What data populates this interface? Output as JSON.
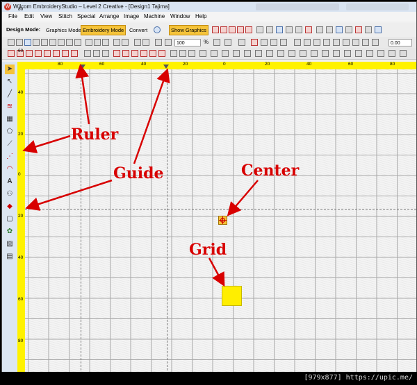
{
  "window": {
    "title": "Wilcom EmbroideryStudio – Level 2 Creative - [Design1      Tajima]",
    "logo": "W"
  },
  "menu": [
    "File",
    "Edit",
    "View",
    "Stitch",
    "Special",
    "Arrange",
    "Image",
    "Machine",
    "Window",
    "Help"
  ],
  "toolbar": {
    "design_mode_label": "Design Mode:",
    "graphics_mode": "Graphics Mode",
    "embroidery_mode": "Embroidery Mode",
    "convert": "Convert",
    "show_graphics": "Show Graphics",
    "zoom_value": "100",
    "zoom_unit": "%",
    "offset_value": "0.00"
  },
  "ruler": {
    "top_labels": [
      "80",
      "60",
      "40",
      "20",
      "0",
      "20",
      "40",
      "60",
      "80"
    ],
    "left_labels": [
      "80",
      "60",
      "40",
      "20",
      "0",
      "20",
      "40",
      "60",
      "80"
    ]
  },
  "annotations": {
    "ruler": "Ruler",
    "guide": "Guide",
    "center": "Center",
    "grid": "Grid",
    "color": "#d80000"
  },
  "footer": {
    "text": "[979x877] https://upic.me/"
  }
}
